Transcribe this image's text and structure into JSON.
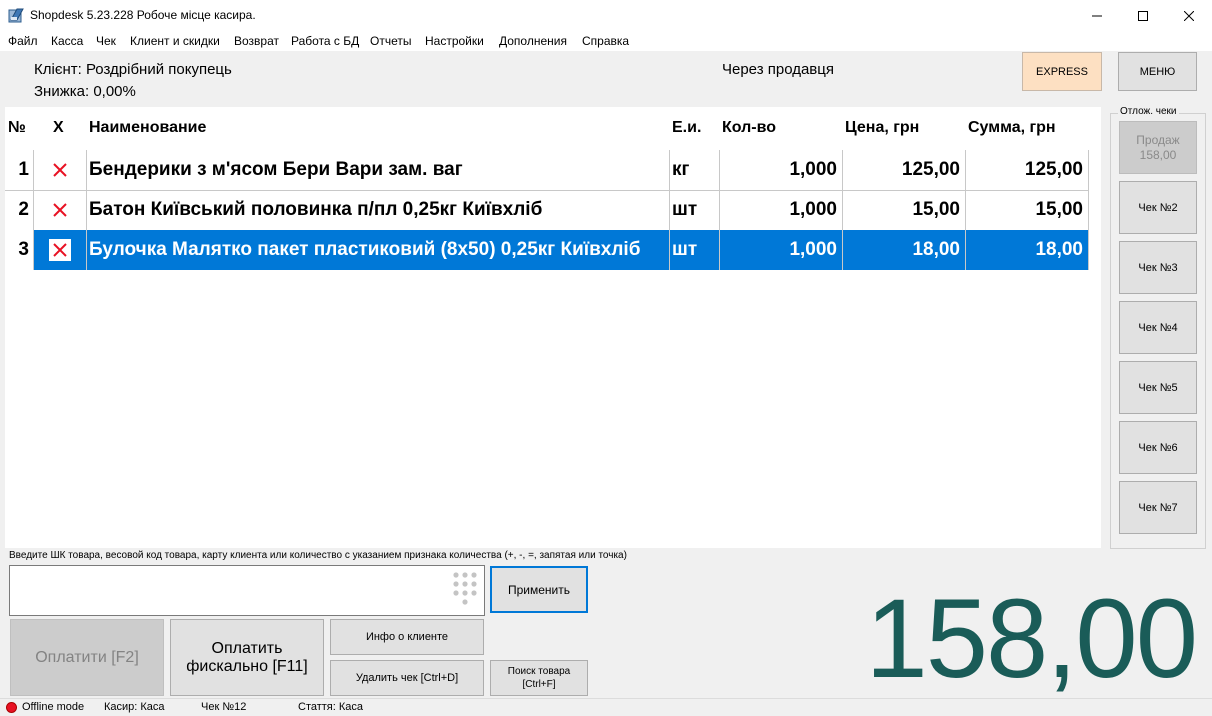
{
  "window": {
    "title": "Shopdesk 5.23.228 Робоче місце касира."
  },
  "menu": [
    "Файл",
    "Касса",
    "Чек",
    "Клиент и скидки",
    "Возврат",
    "Работа с БД",
    "Отчеты",
    "Настройки",
    "Дополнения",
    "Справка"
  ],
  "client": {
    "client_text": "Клієнт: Роздрібний покупець",
    "discount_text": "Знижка: 0,00%",
    "seller_text": "Через продавця"
  },
  "buttons": {
    "express": "EXPRESS",
    "menu": "МЕНЮ",
    "apply": "Применить",
    "pay": "Оплатити [F2]",
    "pay_fiscal_line1": "Оплатить",
    "pay_fiscal_line2": "фискально [F11]",
    "client_info": "Инфо о клиенте",
    "delete_check": "Удалить чек [Ctrl+D]",
    "search_line1": "Поиск товара",
    "search_line2": "[Ctrl+F]"
  },
  "table": {
    "headers": {
      "num": "№",
      "del": "X",
      "name": "Наименование",
      "unit": "Е.и.",
      "qty": "Кол-во",
      "price": "Цена, грн",
      "sum": "Сумма, грн"
    },
    "rows": [
      {
        "num": "1",
        "name": "Бендерики з м'ясом Бери Вари зам. ваг",
        "unit": "кг",
        "qty": "1,000",
        "price": "125,00",
        "sum": "125,00",
        "selected": false
      },
      {
        "num": "2",
        "name": "Батон Київський половинка п/пл 0,25кг Київхліб",
        "unit": "шт",
        "qty": "1,000",
        "price": "15,00",
        "sum": "15,00",
        "selected": false
      },
      {
        "num": "3",
        "name": "Булочка Малятко пакет пластиковий (8х50) 0,25кг Київхліб",
        "unit": "шт",
        "qty": "1,000",
        "price": "18,00",
        "sum": "18,00",
        "selected": true
      }
    ]
  },
  "postponed": {
    "label": "Отлож. чеки",
    "current_title": "Продаж",
    "current_amount": "158,00",
    "checks": [
      "Чек №2",
      "Чек №3",
      "Чек №4",
      "Чек №5",
      "Чек №6",
      "Чек №7"
    ]
  },
  "input": {
    "hint": "Введите ШК товара, весовой код товара,  карту клиента или количество с указанием признака количества (+, -, =, запятая или точка)",
    "value": "",
    "placeholder": ""
  },
  "total": "158,00",
  "status": {
    "mode": "Offline mode",
    "cashier": "Касир: Каса",
    "check": "Чек №12",
    "article": "Стаття: Каса"
  },
  "colors": {
    "selection": "#0078d7",
    "express": "#fde0c2",
    "total": "#1a5c58",
    "delete_x": "#e81123",
    "offline": "#e81123"
  }
}
